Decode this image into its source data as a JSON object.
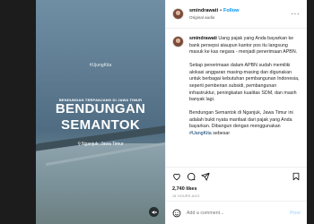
{
  "post": {
    "username": "smindrawati",
    "follow_label": "Follow",
    "audio_label": "Original audio",
    "more_label": "···"
  },
  "media": {
    "hashtag": "#UjungKita",
    "kicker": "BENDUNGAN TERPANJANG DI JAWA TIMUR",
    "title_line1": "BENDUNGAN",
    "title_line2": "SEMANTOK",
    "location": "Nganjuk, Jawa Timur"
  },
  "caption": {
    "username": "smindrawati",
    "p1_text": "Uang pajak yang Anda bayarkan ke bank persepsi ataupun kantor pos itu langsung masuk ke kas negara - menjadi penerimaan APBN.",
    "p2": "Setiap penerimaan dalam APBN sudah memiliki alokasi anggaran masing-masing dan digunakan untuk berbagai kebutuhan pembangunan Indonesia, seperti pemberian subsidi, pembangunan infrastruktur, peningkatan kualitas SDM, dan masih banyak lagi.",
    "p3_text": "Bendungan Semantok di Nganjuk, Jawa Timur ini adalah bukti nyata manfaat dari pajak yang Anda bayarkan. Dibangun dengan menggunakan",
    "p3_tag": "#UangKita",
    "p3_tail": "sebesar"
  },
  "stats": {
    "likes": "2,740 likes",
    "time": "18 HOURS AGO"
  },
  "comment": {
    "placeholder": "Add a comment...",
    "post_label": "Post"
  }
}
